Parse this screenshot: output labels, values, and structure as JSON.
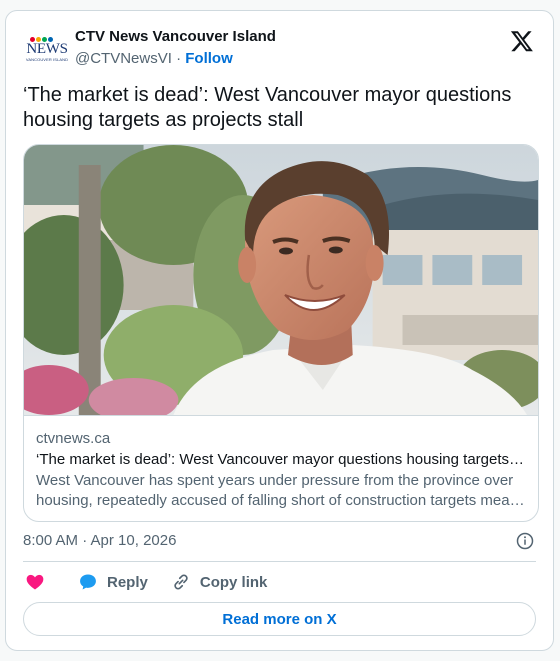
{
  "account": {
    "display_name": "CTV News Vancouver Island",
    "handle": "@CTVNewsVI",
    "separator": "·",
    "follow_label": "Follow",
    "avatar_logo_text": "NEWS",
    "avatar_logo_subtext": "VANCOUVER ISLAND"
  },
  "tweet": {
    "text": "‘The market is dead’: West Vancouver mayor questions housing targets as projects stall",
    "timestamp": "8:00 AM · Apr 10, 2026"
  },
  "link_card": {
    "domain": "ctvnews.ca",
    "title": "‘The market is dead’: West Vancouver mayor questions housing targets…",
    "description": "West Vancouver has spent years under pressure from the province over housing, repeatedly accused of falling short of construction targets mea…"
  },
  "actions": {
    "reply_label": "Reply",
    "copy_link_label": "Copy link",
    "read_more_label": "Read more on X"
  },
  "icons": {
    "avatar": "ctv-news-logo",
    "platform": "x-logo",
    "info": "info-icon",
    "like": "heart-icon",
    "reply": "speech-bubble-icon",
    "copy": "link-icon"
  },
  "colors": {
    "link_blue": "#006fd6",
    "like_pink": "#f91880",
    "reply_blue": "#1d9bf0",
    "text_secondary": "#536471",
    "border": "#cfd9de"
  }
}
